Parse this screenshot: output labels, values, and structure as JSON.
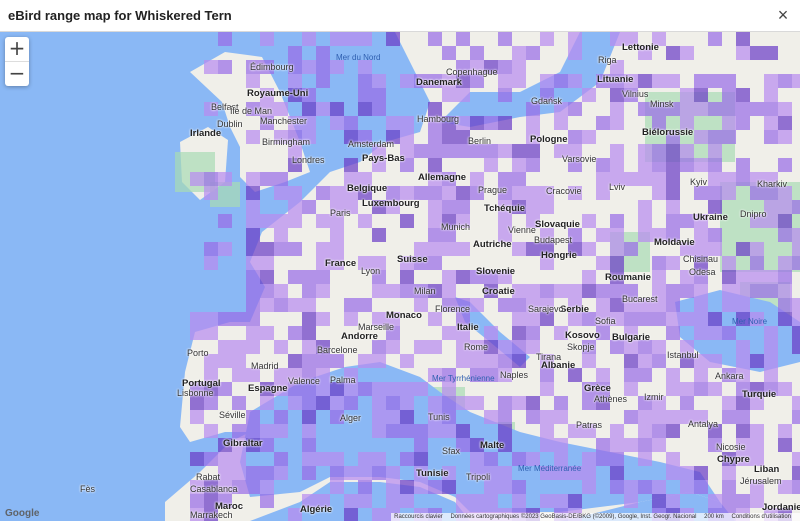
{
  "window": {
    "title": "eBird range map for Whiskered Tern",
    "close_glyph": "×"
  },
  "zoom": {
    "in": "+",
    "out": "−"
  },
  "map": {
    "colors": {
      "sea": "#8ab8f5",
      "land": "#f0efe9",
      "green": "#a8dcb3",
      "range_light": "#b88cf0",
      "range_mid": "#9a6ee8",
      "range_dark": "#6c3ec7"
    },
    "labels": {
      "seas": [
        "Mer du Nord",
        "Mer Noire",
        "Mer Tyrrhénienne",
        "Mer Méditerranée"
      ],
      "countries": [
        "Royaume-Uni",
        "Irlande",
        "Danemark",
        "Lettonie",
        "Lituanie",
        "Biélorussie",
        "Pologne",
        "Pays-Bas",
        "Belgique",
        "Allemagne",
        "Tchéquie",
        "Luxembourg",
        "Slovaquie",
        "Ukraine",
        "Moldavie",
        "France",
        "Suisse",
        "Autriche",
        "Hongrie",
        "Roumanie",
        "Slovenie",
        "Croatie",
        "Serbie",
        "Italie",
        "Monaco",
        "Andorre",
        "Bulgarie",
        "Portugal",
        "Espagne",
        "Grèce",
        "Turquie",
        "Albanie",
        "Kosovo",
        "Tunisie",
        "Maroc",
        "Malte",
        "Chypre",
        "Liban",
        "Jordanie",
        "Gibraltar",
        "Algérie"
      ],
      "cities": [
        "Édimbourg",
        "Belfast",
        "Île de Man",
        "Dublin",
        "Manchester",
        "Birmingham",
        "Londres",
        "Amsterdam",
        "Copenhague",
        "Hambourg",
        "Gdańsk",
        "Riga",
        "Vilnius",
        "Minsk",
        "Varsovie",
        "Berlin",
        "Prague",
        "Cracovie",
        "Lviv",
        "Kyiv",
        "Kharkiv",
        "Dnipro",
        "Paris",
        "Munich",
        "Vienne",
        "Budapest",
        "Chisinau",
        "Odesa",
        "Lyon",
        "Milan",
        "Marseille",
        "Florence",
        "Rome",
        "Naples",
        "Bucarest",
        "Sarajevo",
        "Sofia",
        "Skopje",
        "Tirana",
        "Istanbul",
        "Ankara",
        "Izmir",
        "Athènes",
        "Antalya",
        "Barcelone",
        "Madrid",
        "Valence",
        "Lisbonne",
        "Porto",
        "Séville",
        "Palma",
        "Alger",
        "Tunis",
        "Tripoli",
        "Casablanca",
        "Marrakech",
        "Rabat",
        "Fès",
        "Jérusalem",
        "Sfax",
        "Patras",
        "Nicosie"
      ]
    },
    "google_logo": "Google",
    "attribution": [
      "Raccourcis clavier",
      "Données cartographiques ©2023 GeoBasis-DE/BKG (©2009), Google, Inst. Geogr. Nacional",
      "200 km",
      "Conditions d'utilisation"
    ]
  }
}
